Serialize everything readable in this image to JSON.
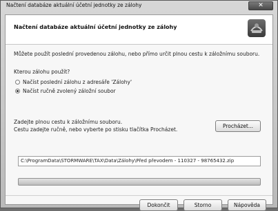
{
  "window": {
    "title": "Načtení databáze aktuální účetní jednotky ze zálohy",
    "close_glyph": "✕"
  },
  "header": {
    "title": "Načtení databáze aktuální účetní jednotky ze zálohy",
    "icon": "database-wizard-icon"
  },
  "intro": "Můžete použít poslední provedenou zálohu, nebo přímo určit plnou cestu k záložnímu souboru.",
  "question": "Kterou zálohu použít?",
  "options": [
    {
      "label": "Načíst poslední zálohu z adresáře 'Zálohy'",
      "checked": false
    },
    {
      "label": "Načíst ručně zvolený záložní soubor",
      "checked": true
    }
  ],
  "path_help": {
    "line1": "Zadejte plnou cestu k záložnímu souboru.",
    "line2": "Cestu zadejte ručně, nebo vyberte po stisku tlačítka Procházet."
  },
  "browse_label": "Procházet...",
  "path_value": "C:\\ProgramData\\STORMWARE\\TAX\\Data\\Zálohy\\Před převodem - 110327 - 98765432.zip",
  "progress": {
    "fraction": 0
  },
  "footer": {
    "finish": "Dokončit",
    "cancel": "Storno",
    "help": "Nápověda"
  }
}
